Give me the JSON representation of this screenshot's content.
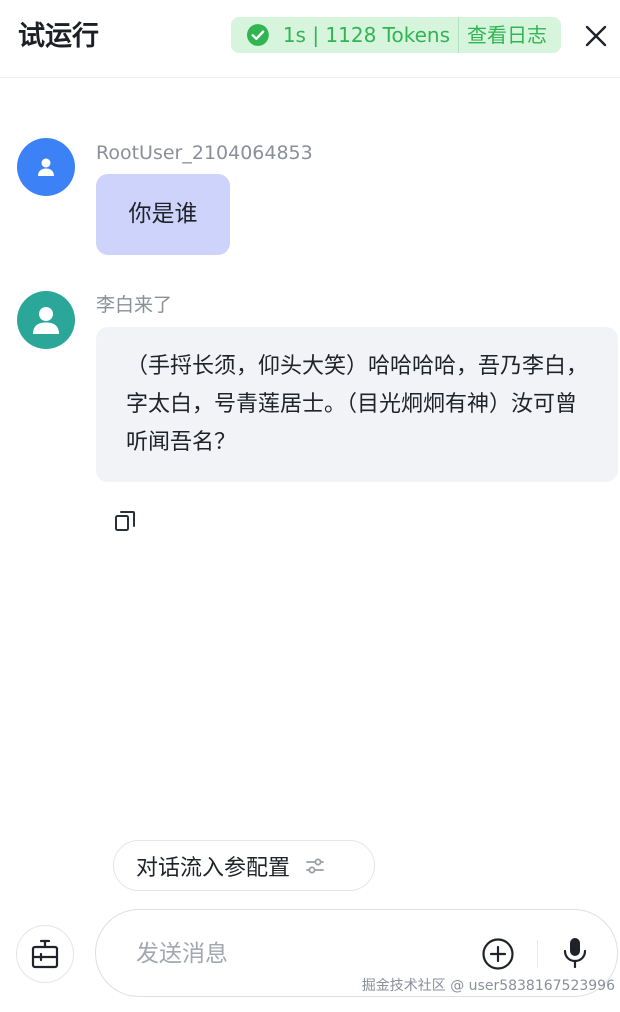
{
  "header": {
    "title": "试运行",
    "run_stats": "1s | 1128 Tokens",
    "view_log": "查看日志"
  },
  "messages": [
    {
      "role": "user",
      "sender": "RootUser_2104064853",
      "text": "你是谁"
    },
    {
      "role": "bot",
      "sender": "李白来了",
      "text": "（手捋长须，仰头大笑）哈哈哈哈，吾乃李白，字太白，号青莲居士。（目光炯炯有神）汝可曾听闻吾名？"
    }
  ],
  "config_chip": {
    "label": "对话流入参配置"
  },
  "composer": {
    "placeholder": "发送消息",
    "value": ""
  },
  "watermark": "掘金技术社区 @ user5838167523996",
  "colors": {
    "success_green": "#31b552",
    "success_bg": "#d7f5dd",
    "user_avatar": "#3c82f6",
    "bot_avatar": "#2ba79a",
    "user_bubble": "#cdd3fb",
    "bot_bubble": "#f2f3f6"
  },
  "icons": {
    "status": "check-circle-icon",
    "close": "close-icon",
    "copy": "copy-icon",
    "config": "sliders-icon",
    "tool": "toolbox-icon",
    "add": "plus-circle-icon",
    "voice": "microphone-icon"
  }
}
